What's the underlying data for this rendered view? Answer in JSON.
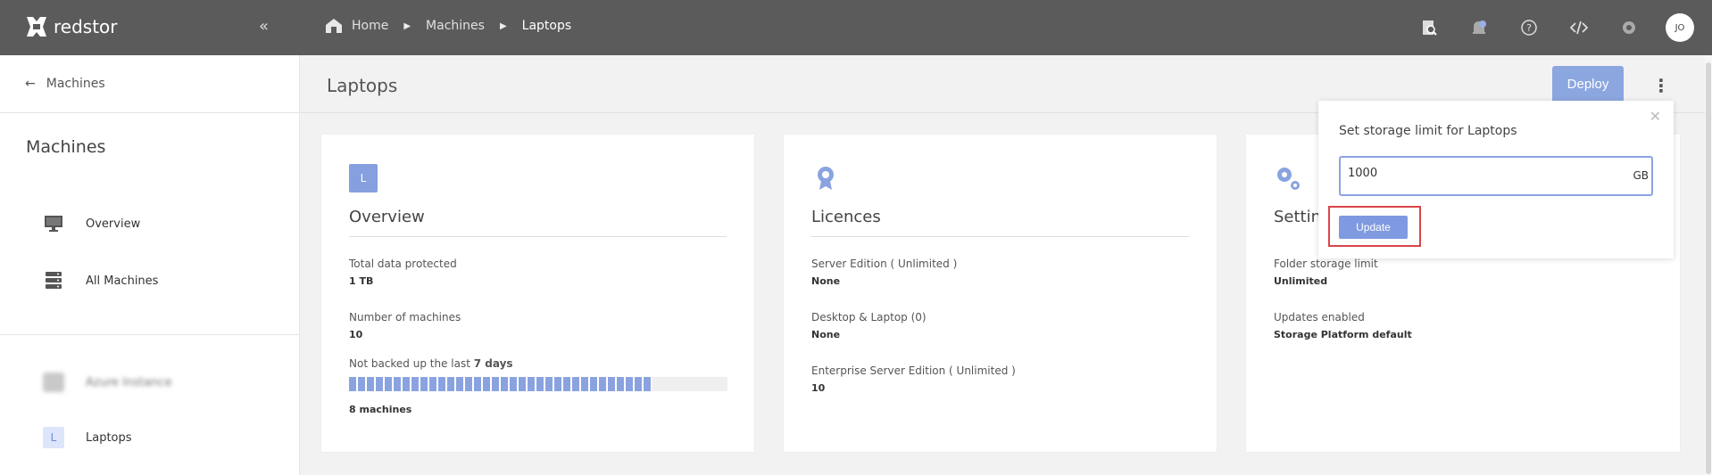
{
  "app": {
    "logo_text": "redstor"
  },
  "breadcrumb": [
    "Home",
    "Machines",
    "Laptops"
  ],
  "topbar": {
    "avatar_initials": "JO"
  },
  "sidebar": {
    "back_label": "Machines",
    "title": "Machines",
    "items": [
      {
        "label": "Overview",
        "icon": "monitor-icon"
      },
      {
        "label": "All Machines",
        "icon": "server-stack-icon"
      }
    ],
    "groups": [
      {
        "label": "Azure Instance",
        "blurred": true
      },
      {
        "label": "Laptops",
        "badge": "L"
      }
    ]
  },
  "main": {
    "title": "Laptops",
    "deploy_label": "Deploy",
    "cards": {
      "overview": {
        "badge": "L",
        "title": "Overview",
        "total_label": "Total data protected",
        "total_value": "1 TB",
        "machines_label": "Number of machines",
        "machines_value": "10",
        "not_backed_prefix": "Not backed up the last ",
        "not_backed_days": "7 days",
        "not_backed_fraction": 0.8,
        "not_backed_value": "8 machines"
      },
      "licences": {
        "title": "Licences",
        "server_label": "Server Edition ( Unlimited )",
        "server_value": "None",
        "desktop_label": "Desktop & Laptop (0)",
        "desktop_value": "None",
        "enterprise_label": "Enterprise Server Edition ( Unlimited )",
        "enterprise_value": "10"
      },
      "settings": {
        "title": "Settin",
        "folder_label": "Folder storage limit",
        "folder_value": "Unlimited",
        "updates_label": "Updates enabled",
        "updates_value": "Storage Platform default"
      }
    }
  },
  "popover": {
    "title": "Set storage limit for Laptops",
    "input_value": "1000",
    "unit": "GB",
    "update_label": "Update"
  },
  "colors": {
    "accent": "#8ca6e0",
    "topbar": "#5b5b5b",
    "highlight": "#d9454a"
  }
}
